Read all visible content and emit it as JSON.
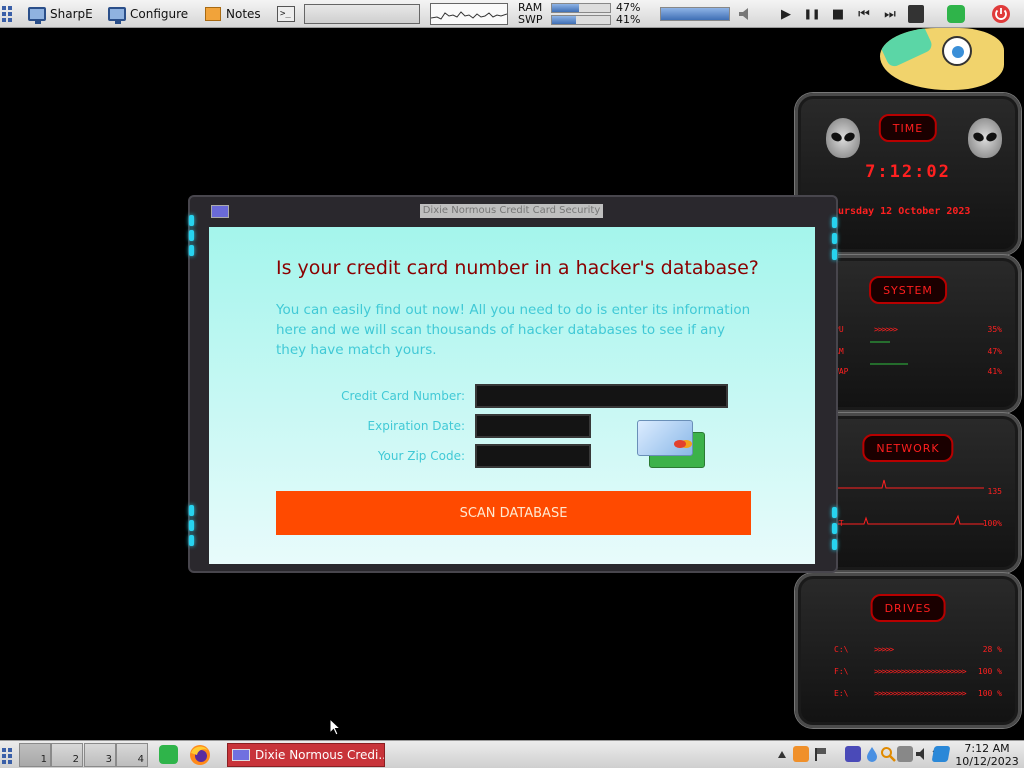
{
  "top_panel": {
    "launchers": [
      {
        "label": "SharpE",
        "icon": "monitor-icon"
      },
      {
        "label": "Configure",
        "icon": "monitor-icon"
      },
      {
        "label": "Notes",
        "icon": "notes-icon"
      }
    ],
    "terminal_glyph": ">_",
    "ram": {
      "label": "RAM",
      "percent": 47,
      "text": "47%"
    },
    "swp": {
      "label": "SWP",
      "percent": 41,
      "text": "41%"
    },
    "volume_level": 100,
    "media": {
      "play": "▶",
      "pause": "❚❚",
      "stop": "■",
      "prev": "⏮",
      "next": "⏭"
    }
  },
  "widgets": {
    "time": {
      "title": "TIME",
      "clock": "7:12:02",
      "date": "ursday 12 October 2023"
    },
    "system": {
      "title": "SYSTEM",
      "rows": [
        {
          "label": "PU",
          "bars": ">>>>>>",
          "value": "35%"
        },
        {
          "label": "AM",
          "bars": "",
          "value": "47%"
        },
        {
          "label": "WAP",
          "bars": "",
          "value": "41%"
        }
      ]
    },
    "network": {
      "title": "NETWORK",
      "rows": [
        {
          "label": "",
          "value": "135"
        },
        {
          "label": "UT",
          "value": "100%"
        }
      ]
    },
    "drives": {
      "title": "DRIVES",
      "rows": [
        {
          "label": "C:\\",
          "bars": ">>>>>",
          "value": "28 %"
        },
        {
          "label": "F:\\",
          "bars": ">>>>>>>>>>>>>>>>>>>>>>>>",
          "value": "100 %"
        },
        {
          "label": "E:\\",
          "bars": ">>>>>>>>>>>>>>>>>>>>>>>>",
          "value": "100 %"
        }
      ]
    }
  },
  "dialog": {
    "window_title": "Dixie Normous Credit Card Security",
    "headline": "Is your credit card number in a hacker's database?",
    "intro": "You can easily find out now! All you need to do is enter its information here and we will scan thousands of hacker databases to see if any they have match yours.",
    "fields": {
      "card_number": {
        "label": "Credit Card Number:",
        "value": ""
      },
      "expiration": {
        "label": "Expiration Date:",
        "value": ""
      },
      "zip": {
        "label": "Your Zip Code:",
        "value": ""
      }
    },
    "scan_button": "SCAN DATABASE",
    "accent_color": "#ff4a00",
    "headline_color": "#8b0000",
    "text_color": "#41c9d6"
  },
  "taskbar": {
    "workspaces": [
      "1",
      "2",
      "3",
      "4"
    ],
    "active_workspace": "1",
    "task_window": "Dixie Normous Credi...",
    "clock_time": "7:12 AM",
    "clock_date": "10/12/2023",
    "tray_icons": [
      "up-arrow-icon",
      "update-icon",
      "flag-icon",
      "security-icon",
      "droplet-icon",
      "search-icon",
      "network-icon",
      "volume-icon",
      "bluetooth-icon",
      "shield-icon"
    ]
  }
}
